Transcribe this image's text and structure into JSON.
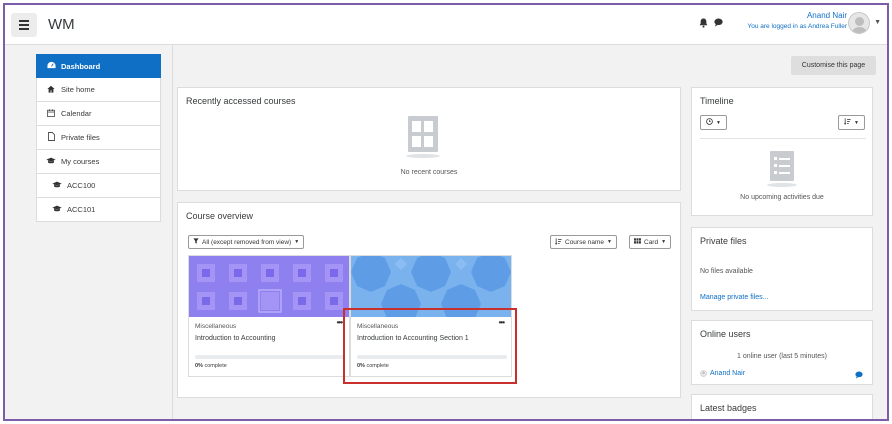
{
  "navbar": {
    "brand": "WM",
    "icons": [
      "bell-icon",
      "chat-icon"
    ],
    "user_name": "Anand Nair",
    "login_note": "You are logged in as Andrea Fuller"
  },
  "drawer": {
    "items": [
      {
        "label": "Dashboard",
        "icon": "dashboard-icon",
        "active": true
      },
      {
        "label": "Site home",
        "icon": "home-icon"
      },
      {
        "label": "Calendar",
        "icon": "calendar-icon"
      },
      {
        "label": "Private files",
        "icon": "file-icon"
      },
      {
        "label": "My courses",
        "icon": "graduation-cap-icon"
      },
      {
        "label": "ACC100",
        "icon": "graduation-cap-icon"
      },
      {
        "label": "ACC101",
        "icon": "graduation-cap-icon"
      }
    ]
  },
  "header": {
    "customise_label": "Customise this page"
  },
  "recent": {
    "title": "Recently accessed courses",
    "empty_text": "No recent courses"
  },
  "overview": {
    "title": "Course overview",
    "filter_label": "All (except removed from view)",
    "sort_label": "Course name",
    "view_label": "Card",
    "courses": [
      {
        "category": "Miscellaneous",
        "name": "Introduction to Accounting",
        "progress": 0,
        "progress_pct": "0%",
        "progress_suffix": " complete"
      },
      {
        "category": "Miscellaneous",
        "name": "Introduction to Accounting Section 1",
        "progress": 0,
        "progress_pct": "0%",
        "progress_suffix": " complete"
      }
    ]
  },
  "timeline": {
    "title": "Timeline",
    "empty_text": "No upcoming activities due"
  },
  "private_files": {
    "title": "Private files",
    "empty_text": "No files available",
    "manage_link": "Manage private files..."
  },
  "online_users": {
    "title": "Online users",
    "summary": "1 online user (last 5 minutes)",
    "users": [
      "Anand Nair"
    ]
  },
  "latest_badges": {
    "title": "Latest badges"
  },
  "colors": {
    "accent": "#0f6fc5",
    "frame": "#7b5ea7",
    "highlight": "#c9302c"
  }
}
